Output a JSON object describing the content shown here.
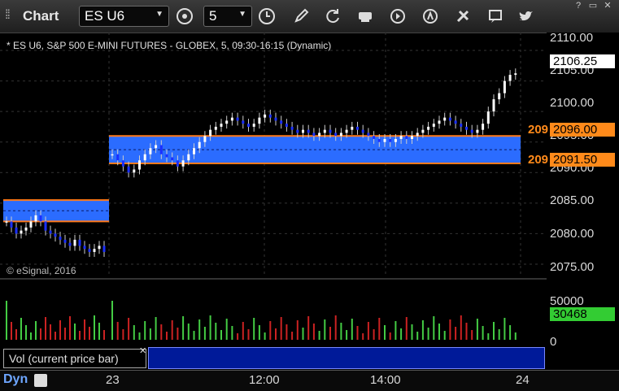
{
  "app": {
    "title": "Chart"
  },
  "toolbar": {
    "symbol": "ES U6",
    "interval": "5",
    "buttons": [
      "symbol-settings-icon",
      "interval-clock-icon",
      "draw-pencil-icon",
      "refresh-icon",
      "get-icon",
      "play-icon",
      "alert-icon",
      "tools-icon",
      "comment-icon",
      "twitter-icon"
    ]
  },
  "chart": {
    "header": "* ES U6, S&P 500 E-MINI FUTURES - GLOBEX, 5, 09:30-16:15 (Dynamic)",
    "copyright": "© eSignal, 2016",
    "price_tags": {
      "last": "2106.25",
      "upper": "2096.00",
      "lower": "2091.50",
      "upper_left": "209",
      "lower_left": "209"
    },
    "y_labels": [
      "2110.00",
      "2105.00",
      "2100.00",
      "2095.00",
      "2090.00",
      "2085.00",
      "2080.00",
      "2075.00"
    ],
    "x_labels": [
      "23",
      "12:00",
      "14:00",
      "24"
    ],
    "volume": {
      "label": "Vol (current price bar)",
      "y_labels": [
        "50000",
        "0"
      ],
      "current": "30468"
    },
    "dyn_label": "Dyn",
    "colors": {
      "up": "#ffffff",
      "down": "#1a2fff",
      "zone": "#2b6cff",
      "zone_edge": "#ff7a1a",
      "vol_up": "#44cc44",
      "vol_down": "#cc2222",
      "tag_green": "#33cc33",
      "tag_orange": "#ff8a1a"
    }
  },
  "chart_data": {
    "type": "candlestick",
    "ylim": [
      2073,
      2112
    ],
    "zones": [
      {
        "from": 2082.0,
        "to": 2085.5,
        "span": "prior-day"
      },
      {
        "from": 2091.5,
        "to": 2096.0,
        "span": "current-day"
      }
    ],
    "closes_day1": [
      2082,
      2081,
      2080,
      2080.5,
      2081,
      2082,
      2083,
      2082,
      2080.5,
      2080,
      2079.5,
      2079,
      2078.5,
      2078,
      2079,
      2078,
      2077.5,
      2077,
      2077.5,
      2078,
      2077
    ],
    "closes_day2": [
      2093,
      2092,
      2091,
      2090,
      2090.5,
      2092,
      2093,
      2094,
      2094.5,
      2093,
      2092.5,
      2092,
      2091,
      2092,
      2093,
      2094,
      2095,
      2096,
      2097,
      2097.5,
      2098,
      2098.5,
      2099,
      2098.5,
      2098,
      2097.5,
      2098,
      2099,
      2099.5,
      2099,
      2098.5,
      2098,
      2097.5,
      2097,
      2096.5,
      2097,
      2096.5,
      2096,
      2096.5,
      2097,
      2096.5,
      2096,
      2096.5,
      2097,
      2097.5,
      2097,
      2096.5,
      2096,
      2095.5,
      2095,
      2095.5,
      2095,
      2095.5,
      2096,
      2095.5,
      2096,
      2096.5,
      2097,
      2097.5,
      2098,
      2098.5,
      2099,
      2098.5,
      2098,
      2097.5,
      2097,
      2096.5,
      2097,
      2098,
      2100,
      2102,
      2103,
      2105,
      2106,
      2106.25
    ]
  }
}
